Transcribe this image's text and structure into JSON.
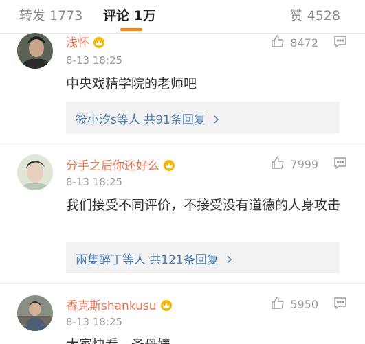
{
  "tabs": {
    "repost": "转发 1773",
    "comments": "评论 1万",
    "likes": "赞 4528"
  },
  "accent_color": "#ff8200",
  "username_color": "#eb7350",
  "reply_link_color": "#507daf",
  "comments": [
    {
      "username": "浅怀",
      "time": "8-13 18:25",
      "text": "中央戏精学院的老师吧",
      "likes": "8472",
      "reply_summary": "筱小汐s等人 共91条回复"
    },
    {
      "username": "分手之后你还好么",
      "time": "8-13 18:25",
      "text": "我们接受不同评价，不接受没有道德的人身攻击",
      "likes": "7999",
      "reply_summary": "兩隻醉丁等人 共121条回复"
    },
    {
      "username": "香克斯shankusu",
      "time": "8-13 18:25",
      "text": "大家快看，圣母婊",
      "likes": "5950"
    }
  ]
}
